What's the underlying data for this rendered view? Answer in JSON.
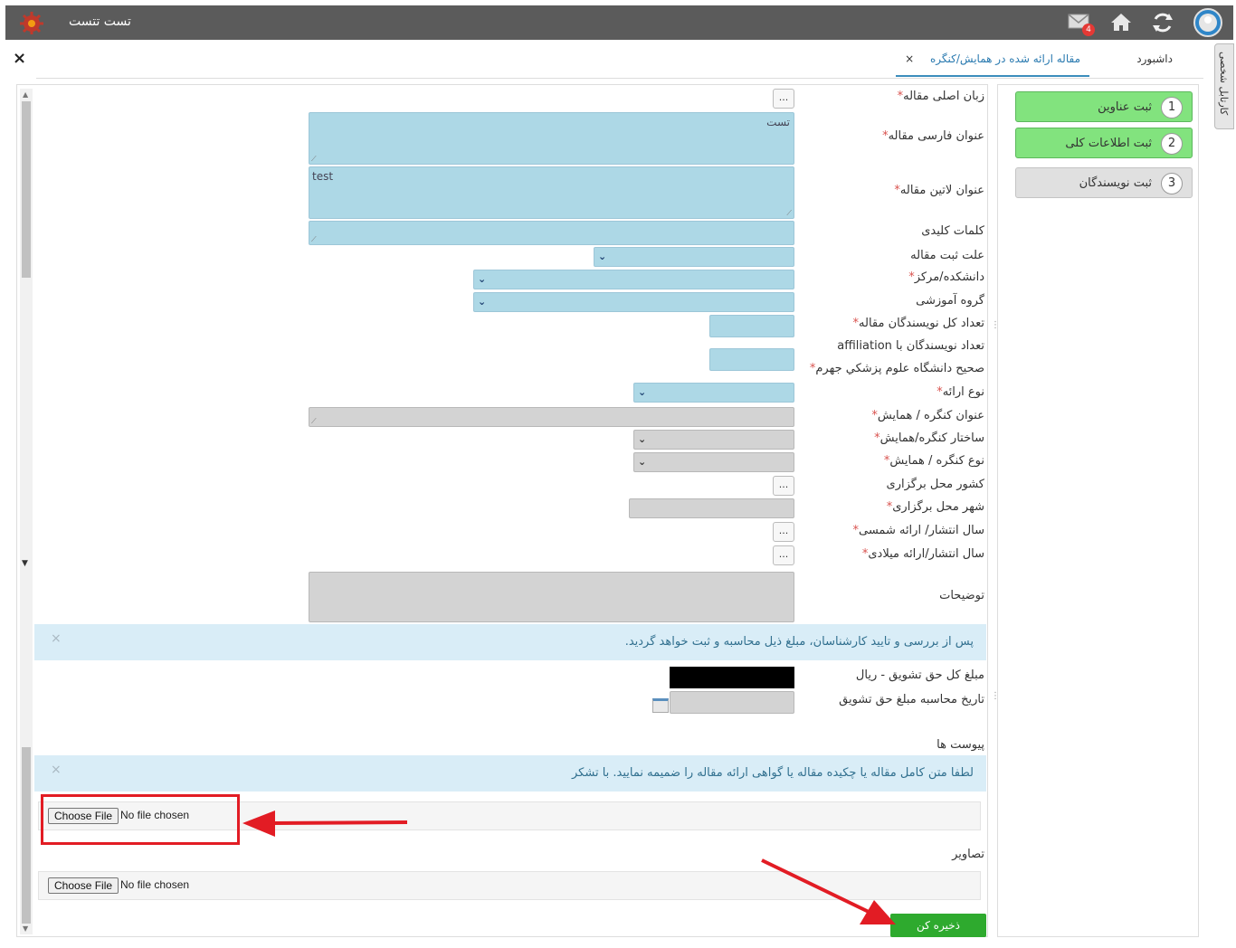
{
  "header": {
    "app_title": "تست تتست",
    "mail_badge": "4",
    "icons": [
      "gear-logo-icon",
      "mail-icon",
      "home-icon",
      "refresh-icon",
      "user-avatar-icon"
    ]
  },
  "side_tab": {
    "label": "کارتابل شخصی"
  },
  "tabs": {
    "home": "داشبورد",
    "active": "مقاله ارائه شده در همایش/کنگره",
    "close_glyph": "×"
  },
  "close_glyph": "×",
  "steps": [
    {
      "num": "1",
      "label": "ثبت عناوین",
      "state": "done"
    },
    {
      "num": "2",
      "label": "ثبت اطلاعات کلی",
      "state": "done"
    },
    {
      "num": "3",
      "label": "ثبت نویسندگان",
      "state": "todo"
    }
  ],
  "form": {
    "labels": {
      "language": "زبان اصلی مقاله",
      "fa_title": "عنوان فارسی مقاله",
      "en_title": "عنوان لاتین مقاله",
      "keywords": "کلمات کلیدی",
      "reason": "علت ثبت مقاله",
      "faculty": "دانشکده/مرکز",
      "group": "گروه آموزشی",
      "authors_count": "تعداد کل نویسندگان مقاله",
      "affiliation_line1": "تعداد نویسندگان با affiliation",
      "affiliation_line2": "صحیح دانشگاه علوم پزشکي جهرم",
      "presentation_type": "نوع ارائه",
      "congress_title": "عنوان کنگره / همایش",
      "congress_structure": "ساختار کنگره/همایش",
      "congress_type": "نوع کنگره / همایش",
      "country": "کشور محل برگزاری",
      "city": "شهر محل برگزاری",
      "year_solar": "سال انتشار/ ارائه شمسی",
      "year_gregorian": "سال انتشار/ارائه میلادی",
      "description": "توضیحات",
      "total_reward": "مبلغ کل حق تشویق - ریال",
      "reward_date": "تاریخ محاسبه مبلغ حق تشویق",
      "attachments": "پیوست ها",
      "images": "تصاویر"
    },
    "required_mark": "*",
    "values": {
      "fa_title": "تست",
      "en_title": "test"
    },
    "ellipsis": "...",
    "alerts": {
      "review": "پس از بررسی و تایید کارشناسان، مبلغ ذیل محاسبه و ثبت خواهد گردید.",
      "attach": "لطفا متن کامل مقاله یا چکیده مقاله یا گواهی ارائه مقاله را ضمیمه نمایید. با تشکر",
      "close": "×"
    },
    "file_inputs": [
      {
        "button": "Choose File",
        "status": "No file chosen"
      },
      {
        "button": "Choose File",
        "status": "No file chosen"
      }
    ],
    "save_button": "ذخیره کن"
  },
  "colors": {
    "topbar": "#5b5b5b",
    "field_blue": "#add8e6",
    "field_gray": "#d3d3d3",
    "step_done": "#82e37e",
    "save_green": "#2eaa2e",
    "annotation_red": "#e21c24"
  }
}
